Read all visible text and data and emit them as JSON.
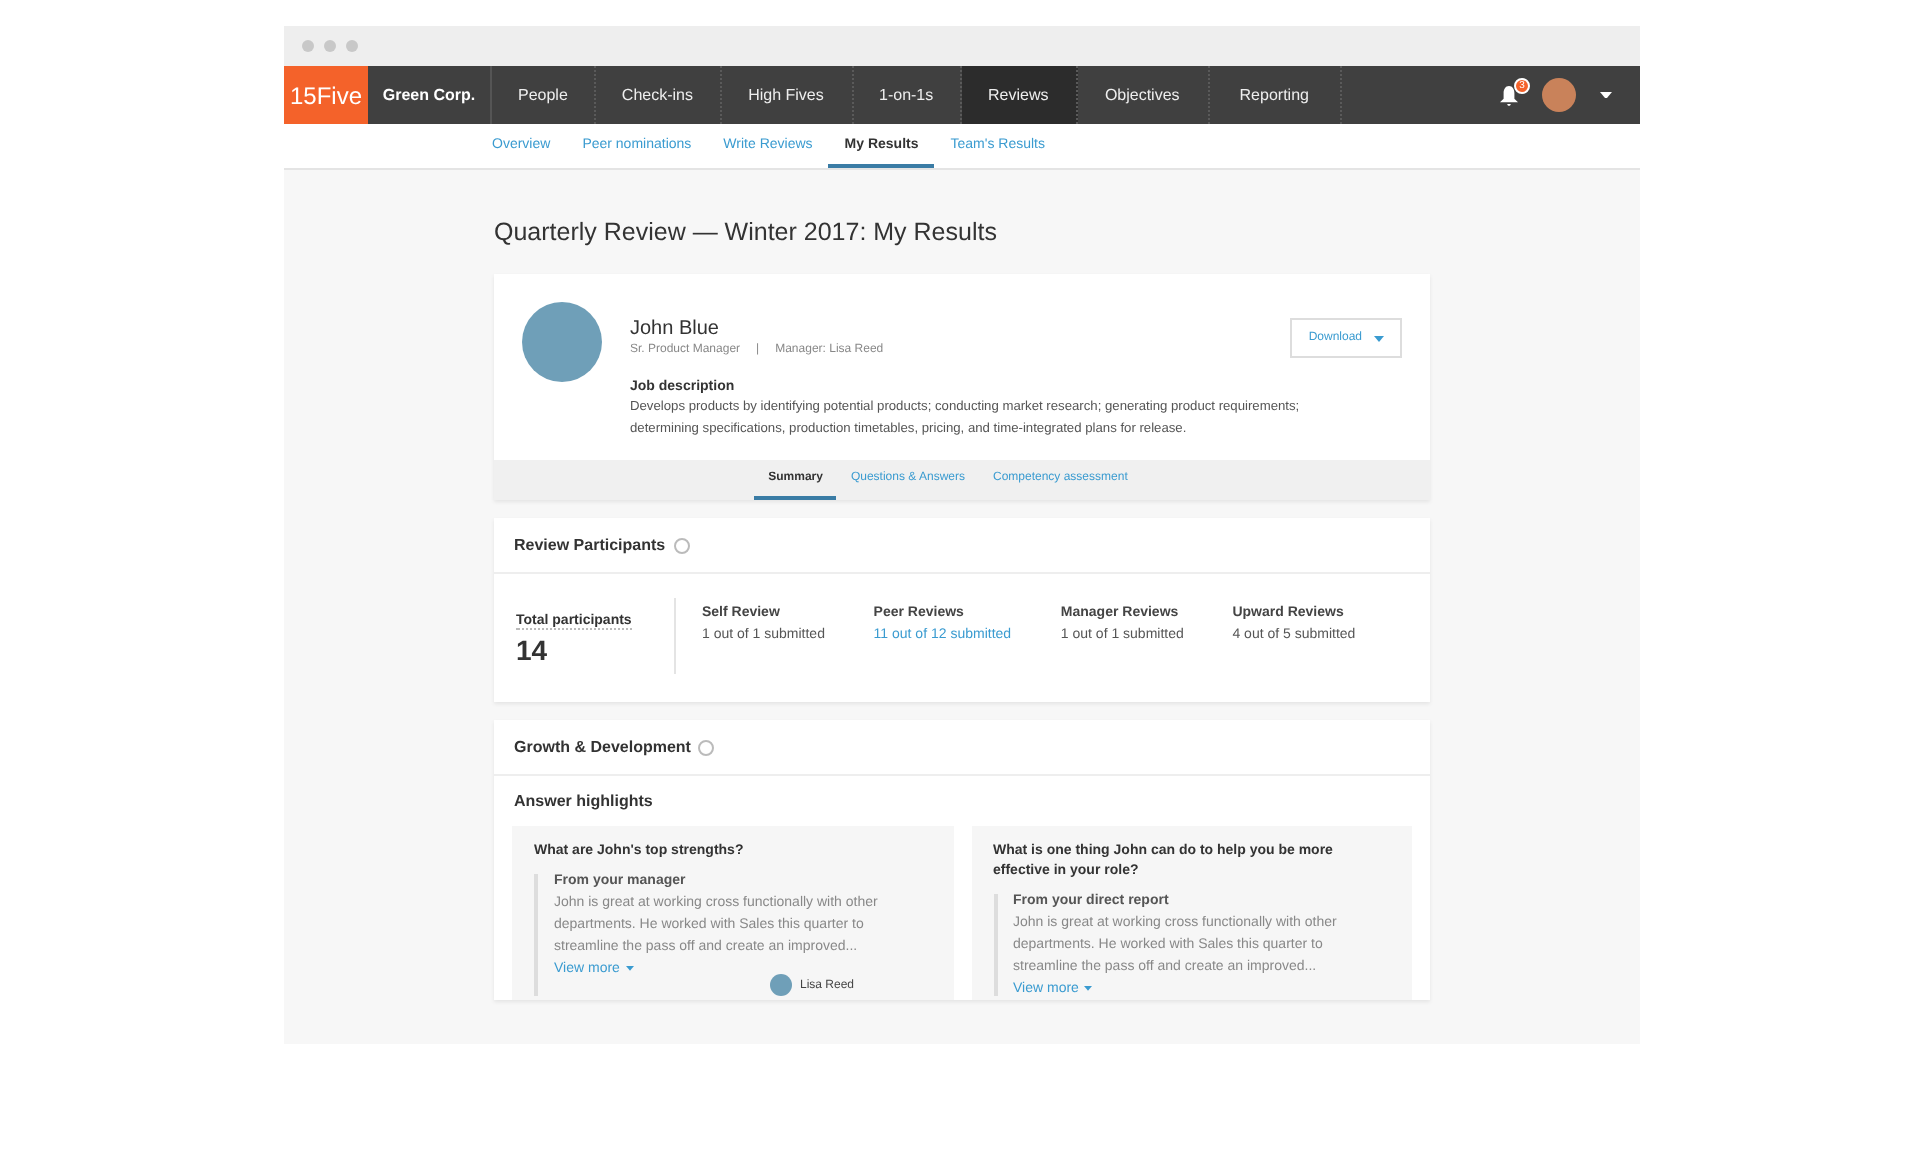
{
  "logo": "15Five",
  "company": "Green Corp.",
  "nav": [
    {
      "label": "People",
      "selected": false
    },
    {
      "label": "Check-ins",
      "selected": false
    },
    {
      "label": "High Fives",
      "selected": false
    },
    {
      "label": "1-on-1s",
      "selected": false
    },
    {
      "label": "Reviews",
      "selected": true
    },
    {
      "label": "Objectives",
      "selected": false
    },
    {
      "label": "Reporting",
      "selected": false
    }
  ],
  "notification_count": "3",
  "subnav": [
    {
      "label": "Overview",
      "selected": false
    },
    {
      "label": "Peer nominations",
      "selected": false
    },
    {
      "label": "Write Reviews",
      "selected": false
    },
    {
      "label": "My Results",
      "selected": true
    },
    {
      "label": "Team's Results",
      "selected": false
    }
  ],
  "page_title": "Quarterly Review — Winter 2017: My Results",
  "profile": {
    "name": "John Blue",
    "role": "Sr. Product Manager",
    "separator": "|",
    "manager": "Manager: Lisa Reed",
    "download": "Download",
    "job_heading": "Job description",
    "job_text": "Develops products by identifying potential products; conducting market research; generating product requirements; determining specifications, production timetables, pricing, and time-integrated plans for release."
  },
  "profile_tabs": [
    {
      "label": "Summary",
      "selected": true
    },
    {
      "label": "Questions & Answers",
      "selected": false
    },
    {
      "label": "Competency assessment",
      "selected": false
    }
  ],
  "participants": {
    "title": "Review Participants",
    "total_label": "Total participants",
    "total": "14",
    "groups": [
      {
        "label": "Self Review",
        "status": "1 out of 1 submitted",
        "link": false
      },
      {
        "label": "Peer Reviews",
        "status": "11 out of 12 submitted",
        "link": true
      },
      {
        "label": "Manager Reviews",
        "status": "1 out of 1 submitted",
        "link": false
      },
      {
        "label": "Upward Reviews",
        "status": "4 out of 5 submitted",
        "link": false
      }
    ]
  },
  "growth": {
    "title": "Growth & Development",
    "subtitle": "Answer highlights",
    "cards": [
      {
        "question": "What are John's top strengths?",
        "source": "From your manager",
        "answer": "John is great at working cross functionally with other departments. He worked with Sales this quarter to streamline the pass off and create an improved...",
        "more": "View more",
        "author": "Lisa Reed"
      },
      {
        "question": "What is one thing John can do to help you be more effective in your role?",
        "source": "From your direct report",
        "answer": "John is great at working cross functionally with other departments. He worked with Sales this quarter to streamline the pass off and create an improved...",
        "more": "View more"
      }
    ]
  }
}
